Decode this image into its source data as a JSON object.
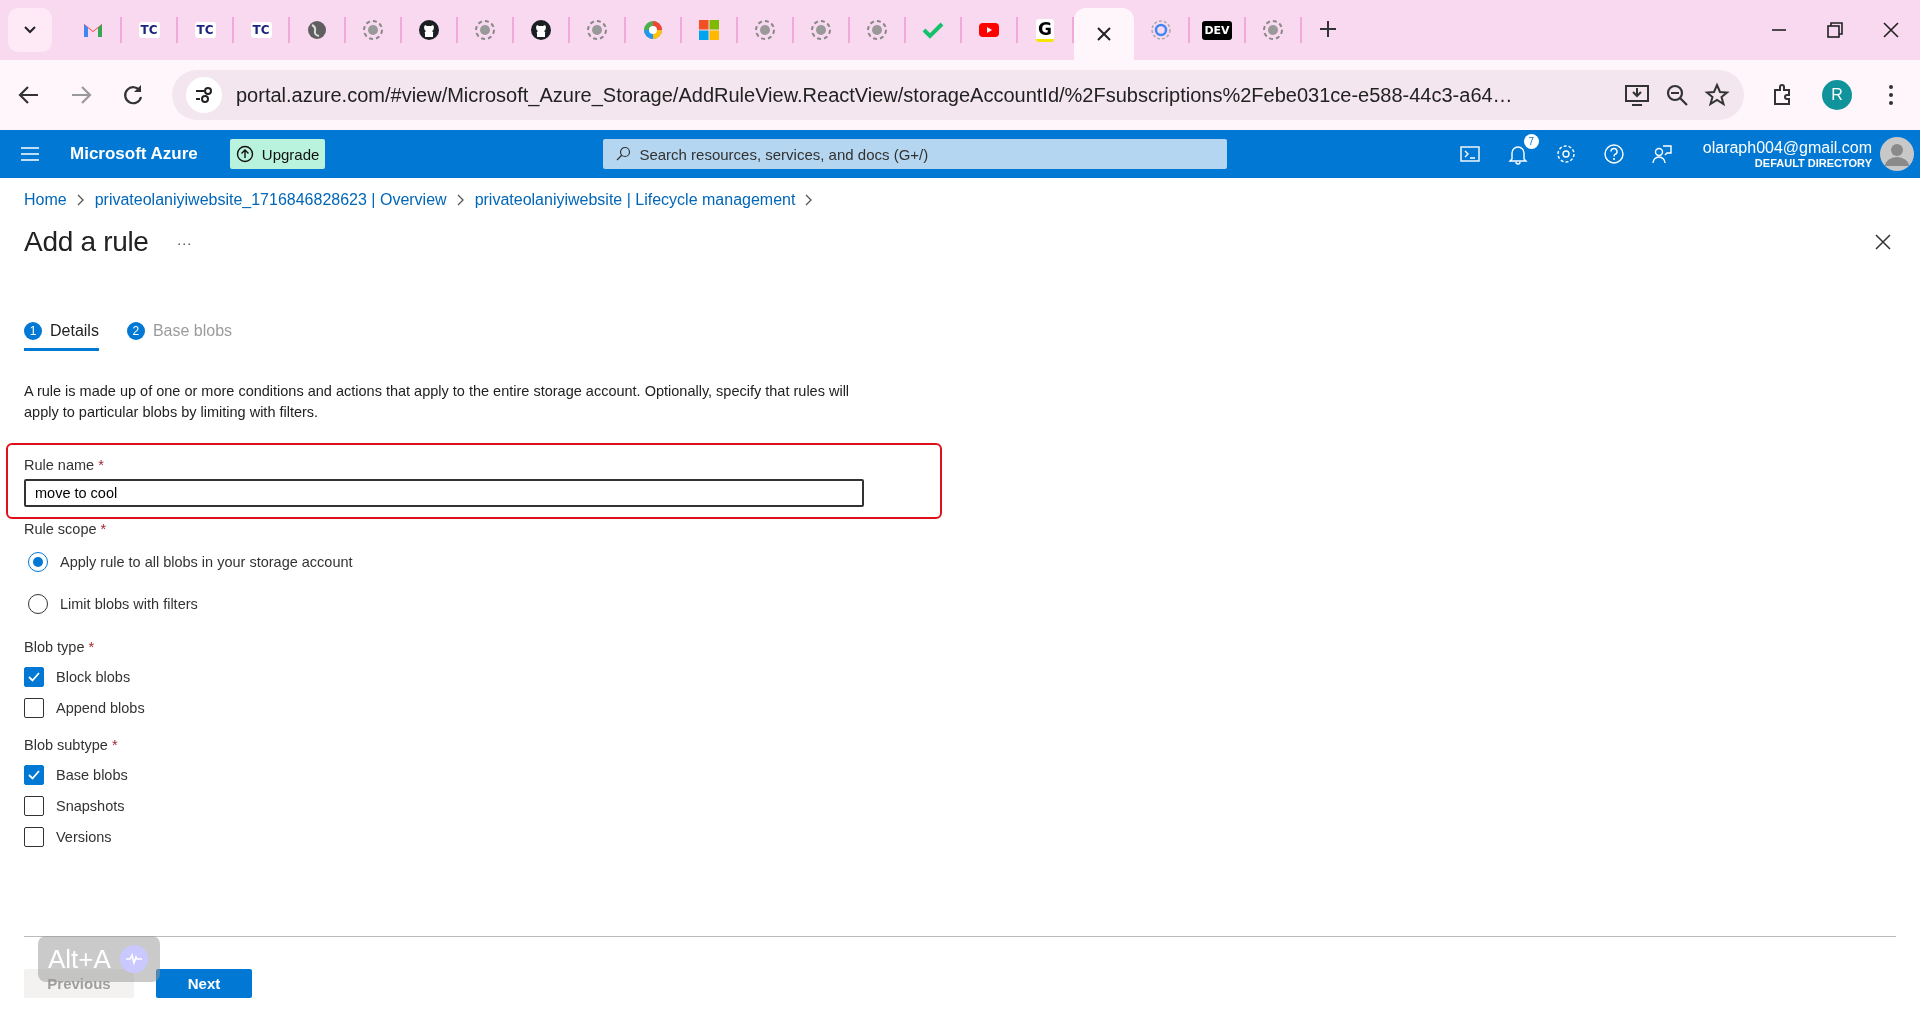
{
  "browser": {
    "tabs": [
      {
        "kind": "gmail",
        "selected": false
      },
      {
        "kind": "tc",
        "logo": "TC",
        "selected": false
      },
      {
        "kind": "tc",
        "logo": "TC",
        "selected": false
      },
      {
        "kind": "tc",
        "logo": "TC",
        "selected": false
      },
      {
        "kind": "globe",
        "selected": false
      },
      {
        "kind": "loading",
        "selected": false
      },
      {
        "kind": "github",
        "selected": false
      },
      {
        "kind": "loading",
        "selected": false
      },
      {
        "kind": "github",
        "selected": false
      },
      {
        "kind": "loading",
        "selected": false
      },
      {
        "kind": "wheel",
        "selected": false
      },
      {
        "kind": "microsoft",
        "selected": false
      },
      {
        "kind": "loading",
        "selected": false
      },
      {
        "kind": "loading",
        "selected": false
      },
      {
        "kind": "loading",
        "selected": false
      },
      {
        "kind": "check",
        "selected": false
      },
      {
        "kind": "youtube",
        "selected": false
      },
      {
        "kind": "letter",
        "logo": "G",
        "selected": false
      },
      {
        "kind": "blank",
        "selected": true
      },
      {
        "kind": "google",
        "selected": false
      },
      {
        "kind": "letter-dark",
        "logo": "DEV",
        "selected": false
      },
      {
        "kind": "loading",
        "selected": false
      }
    ],
    "url": "portal.azure.com/#view/Microsoft_Azure_Storage/AddRuleView.ReactView/storageAccountId/%2Fsubscriptions%2Febe031ce-e588-44c3-a64…",
    "profile": "R"
  },
  "header": {
    "brand": "Microsoft Azure",
    "upgrade": "Upgrade",
    "search_placeholder": "Search resources, services, and docs (G+/)",
    "notifications": "7",
    "account": "olaraph004@gmail.com",
    "directory": "DEFAULT DIRECTORY"
  },
  "breadcrumb": [
    "Home",
    "privateolaniyiwebsite_1716846828623 | Overview",
    "privateolaniyiwebsite | Lifecycle management"
  ],
  "title": "Add a rule",
  "more": "···",
  "steps": [
    {
      "number": "1",
      "label": "Details",
      "selected": true
    },
    {
      "number": "2",
      "label": "Base blobs",
      "selected": false
    }
  ],
  "description": "A rule is made up of one or more conditions and actions that apply to the entire storage account. Optionally, specify that rules will apply to particular blobs by limiting with filters.",
  "rule_name": {
    "label": "Rule name",
    "required": "*",
    "value": "move to cool",
    "highlighted": true
  },
  "rule_scope": {
    "label": "Rule scope",
    "required": "*",
    "options": [
      {
        "label": "Apply rule to all blobs in your storage account",
        "selected": true
      },
      {
        "label": "Limit blobs with filters",
        "selected": false
      }
    ]
  },
  "blob_type": {
    "label": "Blob type",
    "required": "*",
    "options": [
      {
        "label": "Block blobs",
        "checked": true
      },
      {
        "label": "Append blobs",
        "checked": false
      }
    ]
  },
  "blob_subtype": {
    "label": "Blob subtype",
    "required": "*",
    "options": [
      {
        "label": "Base blobs",
        "checked": true
      },
      {
        "label": "Snapshots",
        "checked": false
      },
      {
        "label": "Versions",
        "checked": false
      }
    ]
  },
  "buttons": [
    {
      "label": "Previous",
      "disabled": true
    },
    {
      "label": "Next",
      "disabled": false
    }
  ],
  "overlay": {
    "shortcut": "Alt+A"
  }
}
